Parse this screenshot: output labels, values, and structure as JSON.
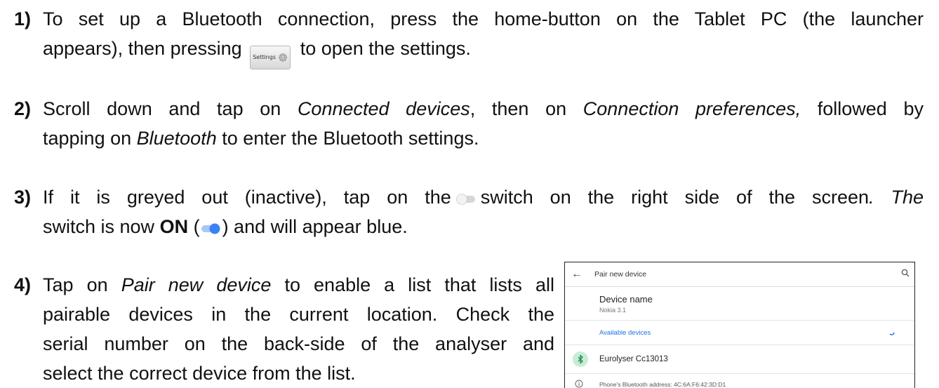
{
  "steps": [
    {
      "num": "1)",
      "line1": "To set up a Bluetooth connection, press the home-button on the Tablet PC (the launcher",
      "line2_pre": "appears), then pressing",
      "settings_icon_label": "Settings",
      "line2_post": "to open the settings."
    },
    {
      "num": "2)",
      "l1_a": "Scroll down and tap on ",
      "l1_b": "Connected devices",
      "l1_c": ", then on ",
      "l1_d": "Connection preferences,",
      "l1_e": " followed by",
      "l2_a": "tapping on ",
      "l2_b": "Bluetooth",
      "l2_c": " to enter the Bluetooth settings."
    },
    {
      "num": "3)",
      "l1_a": "If it is greyed out (inactive), tap on the",
      "l1_b": "switch on the right side of the screen",
      "l1_c": ". The",
      "l2_a": "switch is now ",
      "l2_b": "ON",
      "l2_c": " (",
      "l2_d": ") and will appear blue."
    },
    {
      "num": "4)",
      "lines": [
        "Tap on ",
        "Pair new device",
        " to enable a list that lists all",
        "pairable devices in the current location. Check the",
        "serial number on the back-side of the analyser and",
        "select the correct device from the list."
      ]
    }
  ],
  "screenshot": {
    "title": "Pair new device",
    "device_name_label": "Device name",
    "device_name_value": "Nokia 3.1",
    "available_header": "Available devices",
    "device": "Eurolyser Cc13013",
    "address": "Phone's Bluetooth address: 4C:6A:F6:42:3D:D1"
  },
  "colors": {
    "toggle_on": "#3b82f6",
    "toggle_off": "#cccccc",
    "link_blue": "#1a73e8",
    "bt_green": "#1e8e4e"
  },
  "icons": [
    "settings-gear-icon",
    "toggle-off-icon",
    "toggle-on-icon",
    "back-arrow-icon",
    "search-icon",
    "bluetooth-icon",
    "info-icon",
    "loading-spinner-icon"
  ]
}
